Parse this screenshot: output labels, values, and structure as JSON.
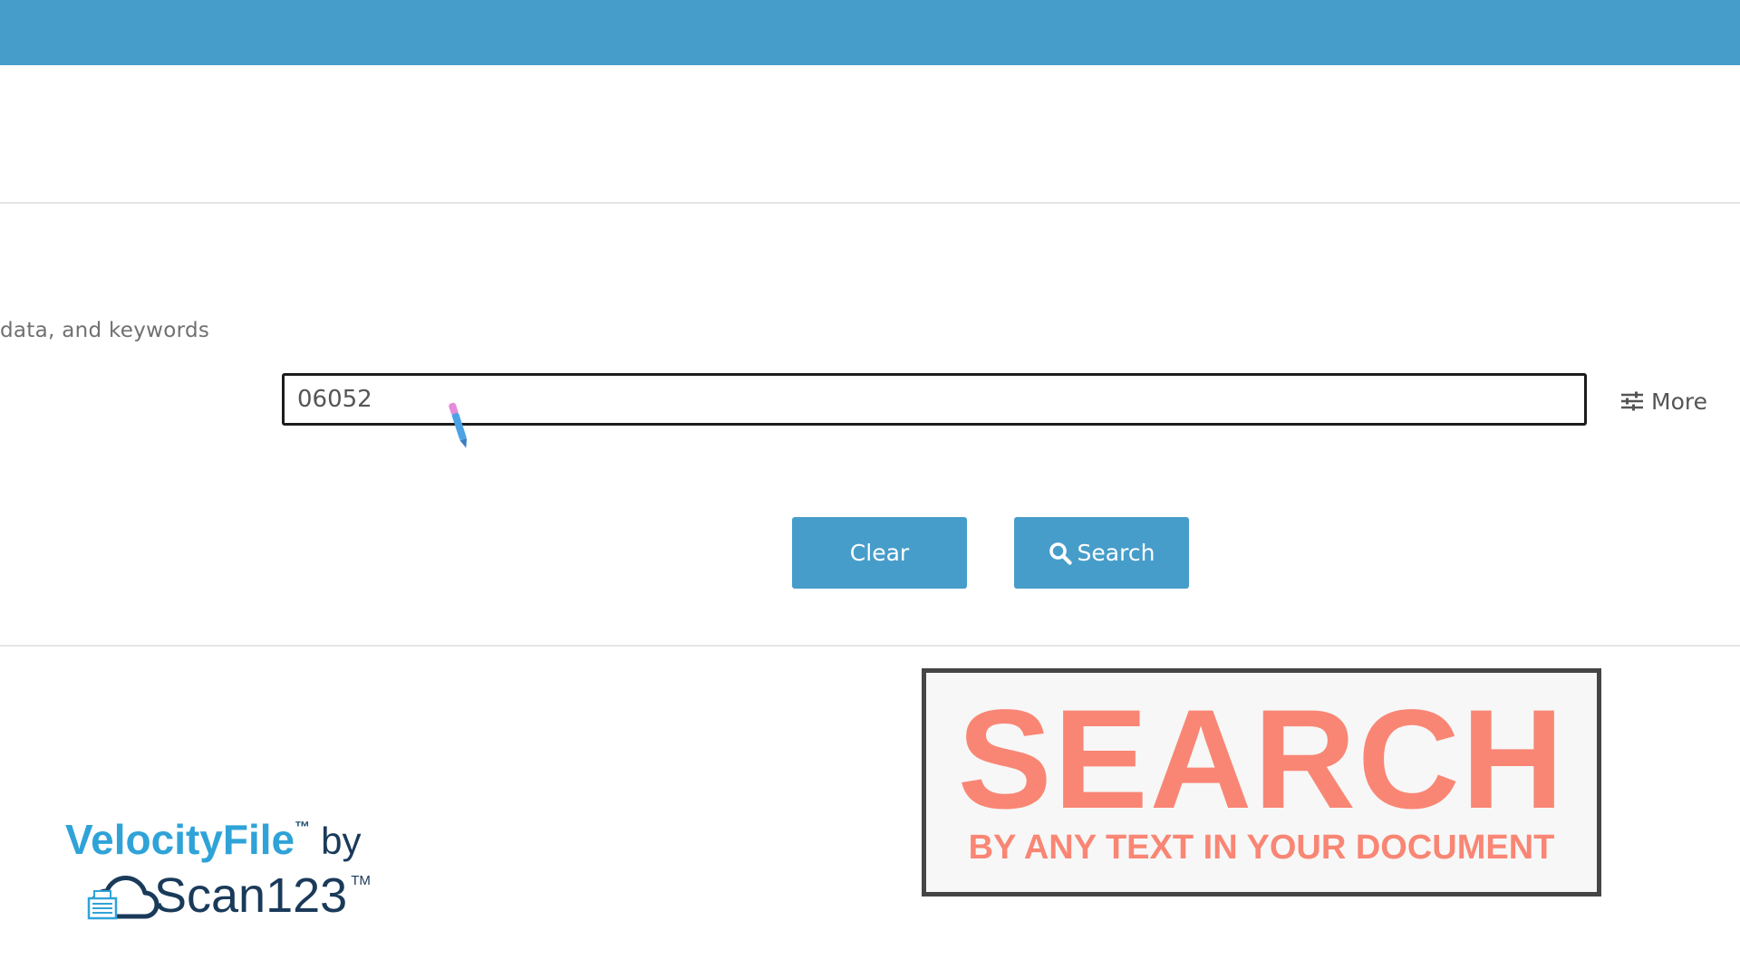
{
  "header": {
    "bar_color": "#479dca"
  },
  "search_form": {
    "hint_text": "data, and keywords",
    "input_value": "06052",
    "more_label": "More",
    "more_icon": "sliders-icon",
    "clear_label": "Clear",
    "search_label": "Search",
    "search_icon": "magnifier-icon",
    "button_color": "#479dca"
  },
  "cursor": {
    "icon": "pen-cursor-icon"
  },
  "logo": {
    "brand": "VelocityFile",
    "trademark": "™",
    "by": "by",
    "company": "Scan123",
    "company_trademark": "TM",
    "brand_color": "#2fa3d8",
    "company_color": "#1a3a5a"
  },
  "promo": {
    "title": "SEARCH",
    "subtitle": "BY ANY TEXT IN YOUR DOCUMENT",
    "text_color": "#f98674",
    "border_color": "#454545"
  }
}
